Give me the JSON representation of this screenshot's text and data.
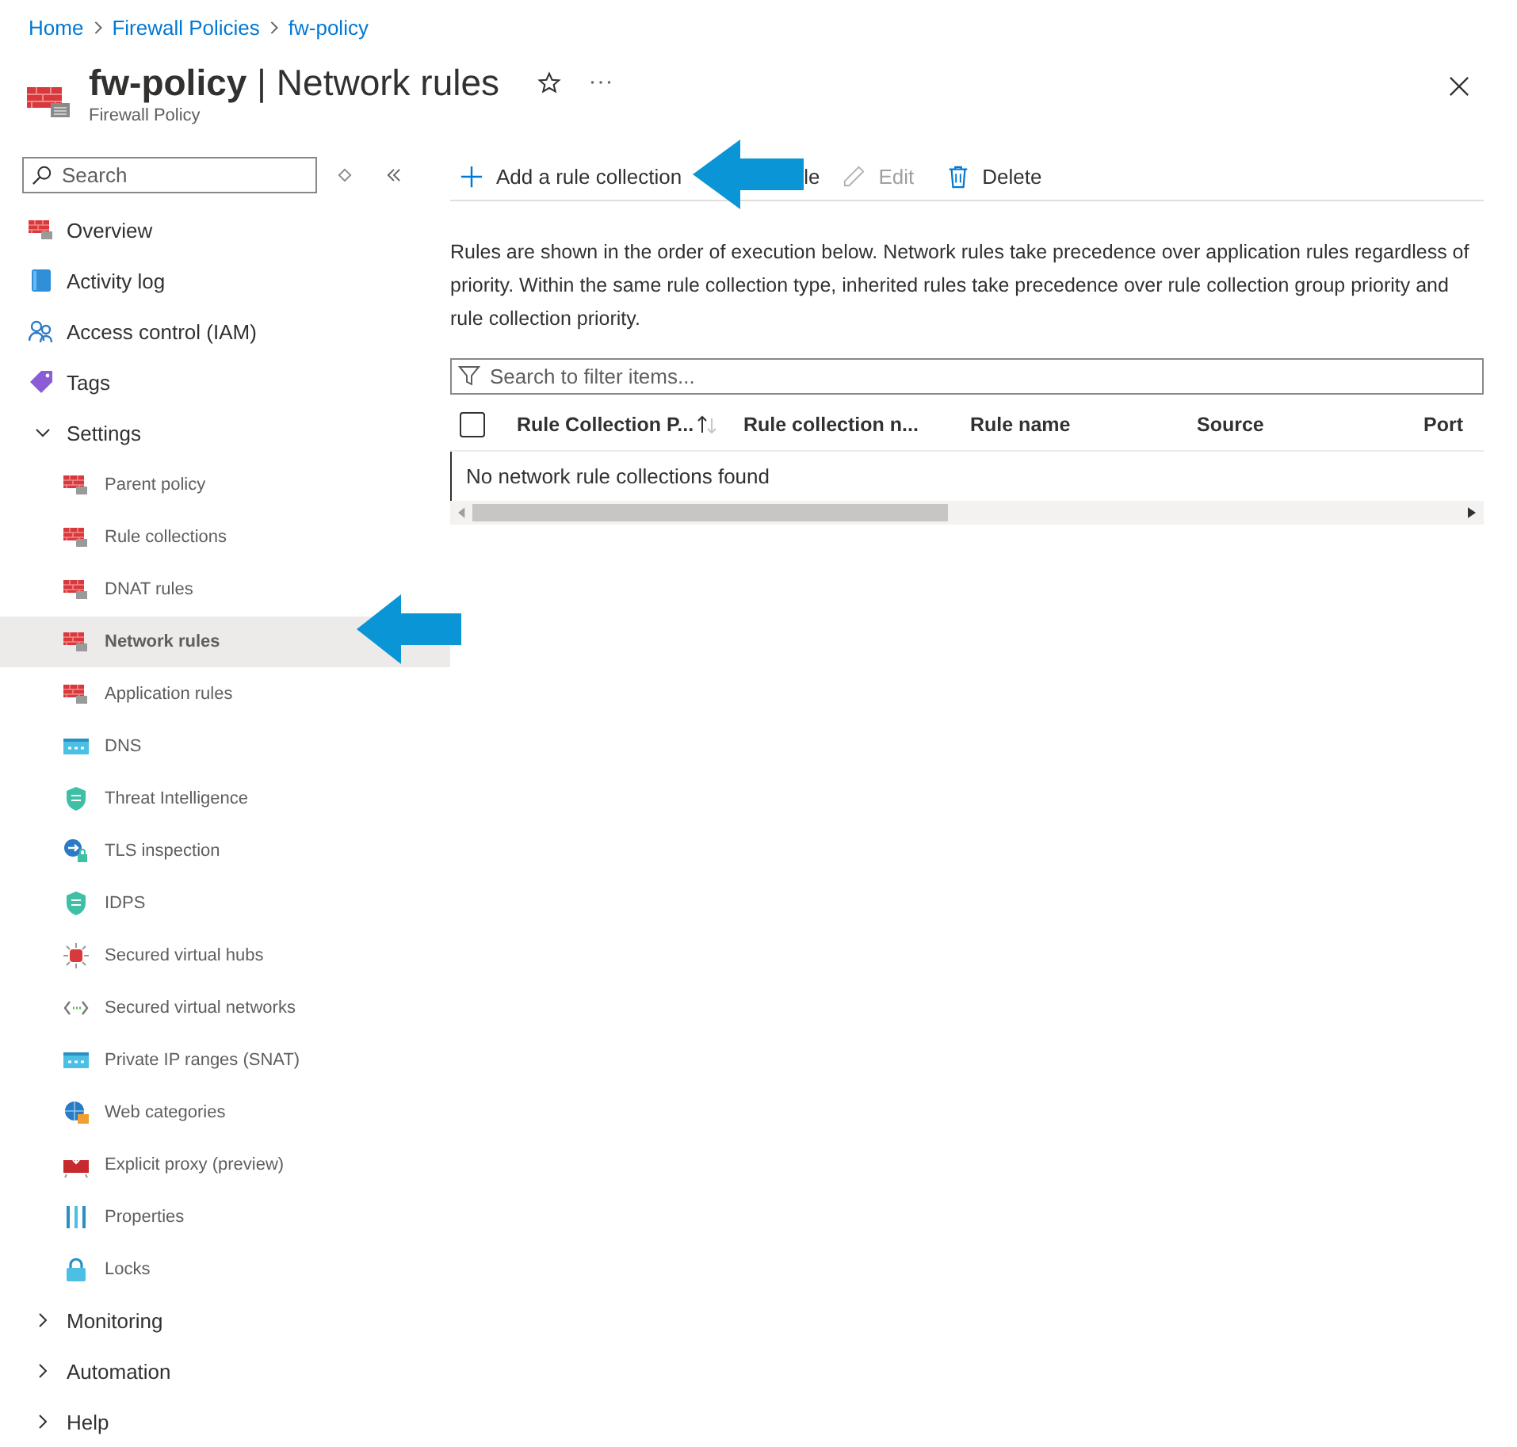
{
  "breadcrumb": [
    "Home",
    "Firewall Policies",
    "fw-policy"
  ],
  "header": {
    "title": "**fw-policy** | Network rules",
    "subtitle": "Firewall Policy",
    "favorite": false
  },
  "sidebar": {
    "search": {
      "placeholder": "Search"
    },
    "items": [
      {
        "label": "Overview",
        "selected": false
      },
      {
        "label": "Activity log",
        "selected": false
      },
      {
        "label": "Access control (IAM)",
        "selected": false
      },
      {
        "label": "Tags",
        "selected": false
      },
      {
        "label": "Settings",
        "selected": false,
        "expanded": true,
        "children": [
          {
            "label": "Parent policy",
            "selected": false
          },
          {
            "label": "Rule collections",
            "selected": false
          },
          {
            "label": "DNAT rules",
            "selected": false
          },
          {
            "label": "Network rules",
            "selected": true
          },
          {
            "label": "Application rules",
            "selected": false
          },
          {
            "label": "DNS",
            "selected": false
          },
          {
            "label": "Threat Intelligence",
            "selected": false
          },
          {
            "label": "TLS inspection",
            "selected": false
          },
          {
            "label": "IDPS",
            "selected": false
          },
          {
            "label": "Secured virtual hubs",
            "selected": false
          },
          {
            "label": "Secured virtual networks",
            "selected": false
          },
          {
            "label": "Private IP ranges (SNAT)",
            "selected": false
          },
          {
            "label": "Web categories",
            "selected": false
          },
          {
            "label": "Explicit proxy (preview)",
            "selected": false
          },
          {
            "label": "Properties",
            "selected": false
          },
          {
            "label": "Locks",
            "selected": false
          }
        ]
      },
      {
        "label": "Monitoring",
        "selected": false,
        "expanded": false
      },
      {
        "label": "Automation",
        "selected": false,
        "expanded": false
      },
      {
        "label": "Help",
        "selected": false,
        "expanded": false
      }
    ]
  },
  "toolbar": [
    {
      "label": "Add a rule collection",
      "kind": "add",
      "disabled": false
    },
    {
      "label": "le",
      "kind": "covered",
      "disabled": false
    },
    {
      "label": "Edit",
      "kind": "edit",
      "disabled": true
    },
    {
      "label": "Delete",
      "kind": "delete",
      "disabled": false
    }
  ],
  "description": "Rules are shown in the order of execution below. Network rules take precedence over application rules regardless of priority. Within the same rule collection type, inherited rules take precedence over rule collection group priority and rule collection priority.",
  "filter": {
    "placeholder": "Search to filter items..."
  },
  "table": {
    "select_all_checked": false,
    "columns": [
      "Rule Collection P...",
      "Rule collection n...",
      "Rule name",
      "Source",
      "Port"
    ],
    "empty_message": "No network rule collections found"
  }
}
